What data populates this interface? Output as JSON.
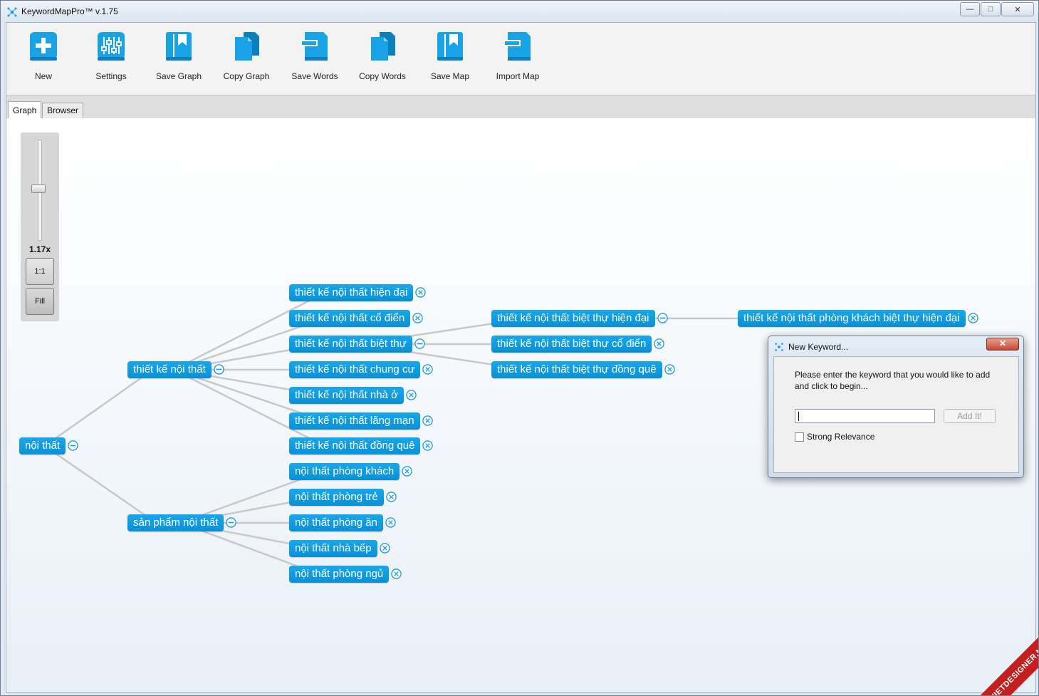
{
  "app": {
    "title": "KeywordMapPro™ v.1.75"
  },
  "window_controls": {
    "minimize": "—",
    "maximize": "□",
    "close": "✕"
  },
  "toolbar": {
    "items": [
      {
        "label": "New",
        "icon": "plus-icon"
      },
      {
        "label": "Settings",
        "icon": "sliders-icon"
      },
      {
        "label": "Save Graph",
        "icon": "bookmark-icon"
      },
      {
        "label": "Copy Graph",
        "icon": "copy-icon"
      },
      {
        "label": "Save Words",
        "icon": "folder-icon"
      },
      {
        "label": "Copy Words",
        "icon": "copy-icon"
      },
      {
        "label": "Save Map",
        "icon": "bookmark-icon"
      },
      {
        "label": "Import Map",
        "icon": "folder-icon"
      }
    ],
    "accent": "#19a3e6"
  },
  "tabs": [
    {
      "label": "Graph",
      "active": true
    },
    {
      "label": "Browser",
      "active": false
    }
  ],
  "zoom": {
    "readout": "1.17x",
    "level": 1.17,
    "one_to_one": "1:1",
    "fill": "Fill"
  },
  "graph": {
    "node_color": "#0f9adb",
    "nodes": [
      {
        "id": "root",
        "label": "nội thất",
        "control": "collapse"
      },
      {
        "id": "n1",
        "label": "thiết kế nội thất",
        "control": "collapse"
      },
      {
        "id": "n2",
        "label": "sản phẩm nội thất",
        "control": "collapse"
      },
      {
        "id": "a1",
        "label": "thiết kế nội thất hiện đại",
        "control": "remove"
      },
      {
        "id": "a2",
        "label": "thiết kế nội thất cổ điển",
        "control": "remove"
      },
      {
        "id": "a3",
        "label": "thiết kế nội thất biệt thự",
        "control": "collapse"
      },
      {
        "id": "a4",
        "label": "thiết kế nội thất chung cư",
        "control": "remove"
      },
      {
        "id": "a5",
        "label": "thiết kế nội thất nhà ở",
        "control": "remove"
      },
      {
        "id": "a6",
        "label": "thiết kế nội thất lãng mạn",
        "control": "remove"
      },
      {
        "id": "a7",
        "label": "thiết kế nội thất đồng quê",
        "control": "remove"
      },
      {
        "id": "b1",
        "label": "nội thất phòng khách",
        "control": "remove"
      },
      {
        "id": "b2",
        "label": "nội thất phòng trẻ",
        "control": "remove"
      },
      {
        "id": "b3",
        "label": "nội thất phòng ăn",
        "control": "remove"
      },
      {
        "id": "b4",
        "label": "nội thất nhà bếp",
        "control": "remove"
      },
      {
        "id": "b5",
        "label": "nội thất phòng ngủ",
        "control": "remove"
      },
      {
        "id": "c1",
        "label": "thiết kế nội thất biệt thự hiện đại",
        "control": "collapse"
      },
      {
        "id": "c2",
        "label": "thiết kế nội thất biệt thự cổ điển",
        "control": "remove"
      },
      {
        "id": "c3",
        "label": "thiết kế nội thất biệt thự đồng quê",
        "control": "remove"
      },
      {
        "id": "d1",
        "label": "thiết kế nội thất phòng khách biệt thự hiện đại",
        "control": "remove"
      }
    ],
    "edges": [
      [
        "root",
        "n1"
      ],
      [
        "root",
        "n2"
      ],
      [
        "n1",
        "a1"
      ],
      [
        "n1",
        "a2"
      ],
      [
        "n1",
        "a3"
      ],
      [
        "n1",
        "a4"
      ],
      [
        "n1",
        "a5"
      ],
      [
        "n1",
        "a6"
      ],
      [
        "n1",
        "a7"
      ],
      [
        "n2",
        "b1"
      ],
      [
        "n2",
        "b2"
      ],
      [
        "n2",
        "b3"
      ],
      [
        "n2",
        "b4"
      ],
      [
        "n2",
        "b5"
      ],
      [
        "a3",
        "c1"
      ],
      [
        "a3",
        "c2"
      ],
      [
        "a3",
        "c3"
      ],
      [
        "c1",
        "d1"
      ]
    ]
  },
  "dialog": {
    "title": "New Keyword...",
    "close": "✕",
    "prompt": "Please enter the keyword that you would like to add and click to begin...",
    "input_value": "",
    "add_button": "Add It!",
    "checkbox_label": "Strong Relevance",
    "checkbox_checked": false
  },
  "watermark": {
    "text": "VIETDESIGNER.NET"
  }
}
